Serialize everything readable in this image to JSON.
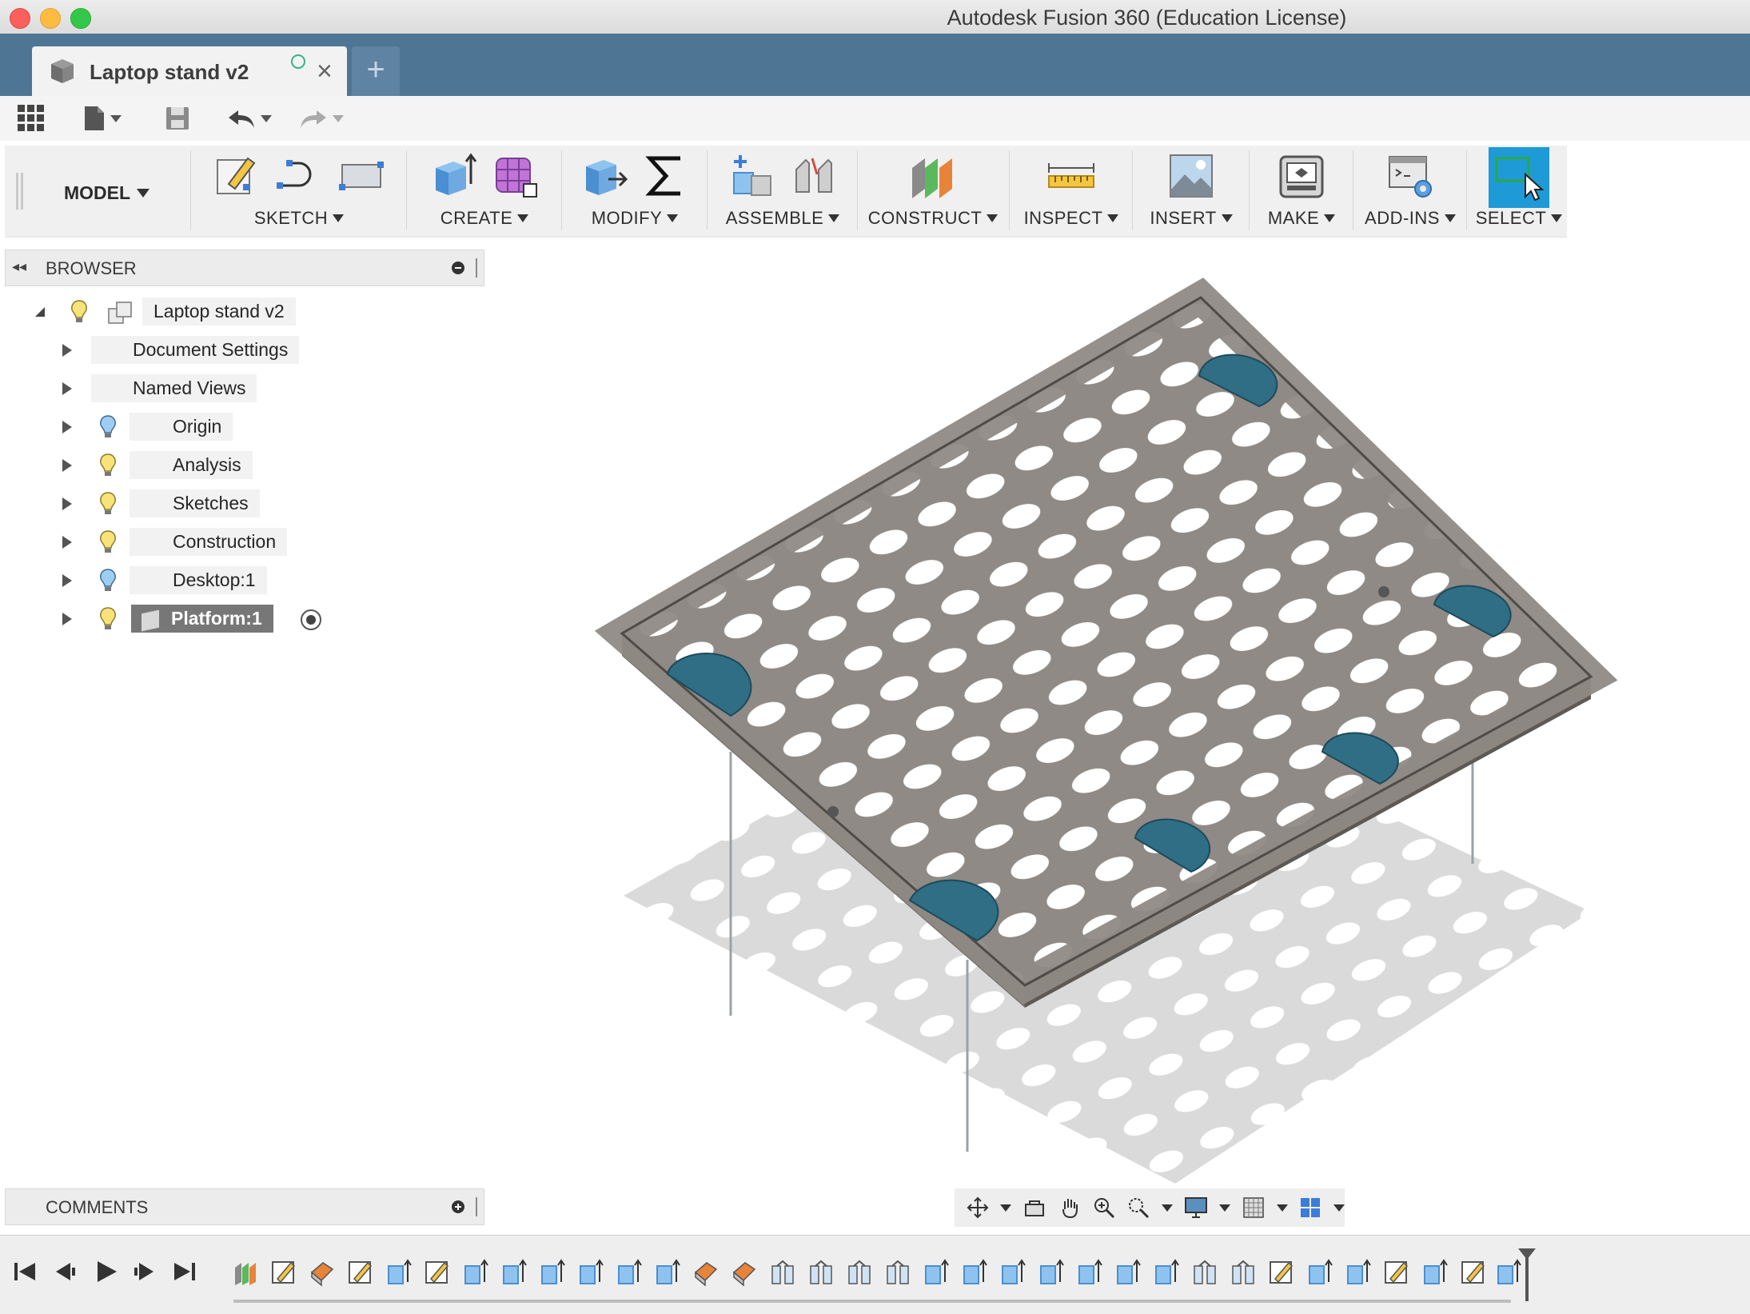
{
  "window": {
    "title": "Autodesk Fusion 360 (Education License)"
  },
  "tab": {
    "label": "Laptop stand v2",
    "new_tab": "+"
  },
  "ribbon": {
    "workspace": "MODEL",
    "groups": [
      {
        "label": "SKETCH"
      },
      {
        "label": "CREATE"
      },
      {
        "label": "MODIFY"
      },
      {
        "label": "ASSEMBLE"
      },
      {
        "label": "CONSTRUCT"
      },
      {
        "label": "INSPECT"
      },
      {
        "label": "INSERT"
      },
      {
        "label": "MAKE"
      },
      {
        "label": "ADD-INS"
      },
      {
        "label": "SELECT"
      }
    ]
  },
  "browser": {
    "title": "BROWSER",
    "root": "Laptop stand v2",
    "items": [
      {
        "label": "Document Settings",
        "icon": "gear-icon"
      },
      {
        "label": "Named Views",
        "icon": "folder-icon"
      },
      {
        "label": "Origin",
        "icon": "folder-icon",
        "bulb": "blue"
      },
      {
        "label": "Analysis",
        "icon": "folder-icon",
        "bulb": "yellow"
      },
      {
        "label": "Sketches",
        "icon": "folder-icon",
        "bulb": "yellow"
      },
      {
        "label": "Construction",
        "icon": "folder-icon",
        "bulb": "yellow"
      },
      {
        "label": "Desktop:1",
        "icon": "body-icon",
        "bulb": "blue"
      },
      {
        "label": "Platform:1",
        "icon": "body-icon",
        "bulb": "yellow",
        "selected": true
      }
    ]
  },
  "comments": {
    "title": "COMMENTS"
  },
  "colors": {
    "tabbar": "#4f7595",
    "select_accent": "#1e9ad6",
    "model_top": "#8e8a85",
    "pad_teal": "#2f6e84"
  }
}
